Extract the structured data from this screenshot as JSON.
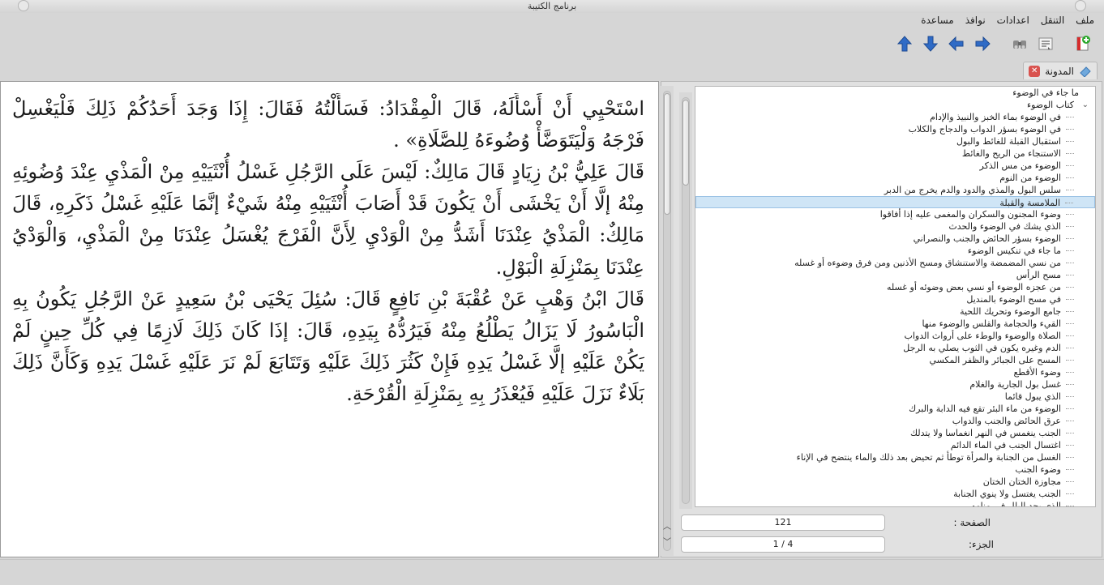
{
  "window": {
    "title": "برنامج الكتيبة"
  },
  "menu": [
    "ملف",
    "التنقل",
    "اعدادات",
    "نوافذ",
    "مساعدة"
  ],
  "toolbar": {
    "buttons": [
      "new-page-icon",
      "list-icon",
      "binoculars-icon",
      "arrow-right-icon",
      "arrow-left-icon",
      "arrow-down-icon",
      "arrow-up-icon"
    ]
  },
  "dock": {
    "tab_label": "المدونة"
  },
  "text": {
    "paragraphs": [
      "اسْتَحْيِي أَنْ أَسْأَلَهُ، قَالَ الْمِقْدَادُ: فَسَأَلْتُهُ فَقَالَ: إِذَا وَجَدَ أَحَدُكُمْ ذَلِكَ فَلْيَغْسِلْ فَرْجَهُ وَلْيَتَوَضَّأْ وُضُوءَهُ لِلصَّلَاةِ» .",
      "قَالَ عَلِيُّ بْنُ زِيَادٍ قَالَ مَالِكٌ: لَيْسَ عَلَى الرَّجُلِ غَسْلُ أُنْثَيَيْهِ مِنْ الْمَذْيِ عِنْدَ وُضُوئِهِ مِنْهُ إلَّا أَنْ يَخْشَى أَنْ يَكُونَ قَدْ أَصَابَ أُنْثَيَيْهِ مِنْهُ شَيْءٌ إنَّمَا عَلَيْهِ غَسْلُ ذَكَرِهِ، قَالَ مَالِكٌ: الْمَذْيُ عِنْدَنَا أَشَدُّ مِنْ الْوَدْيِ لِأَنَّ الْفَرْجَ يُغْسَلُ عِنْدَنَا مِنْ الْمَذْيِ، وَالْوَدْيُ عِنْدَنَا بِمَنْزِلَةِ الْبَوْلِ.",
      "قَالَ ابْنُ وَهْبٍ عَنْ عُقْبَةَ بْنِ نَافِعٍ قَالَ: سُئِلَ يَحْيَى بْنُ سَعِيدٍ عَنْ الرَّجُلِ يَكُونُ بِهِ الْبَاسُورُ لَا يَزَالُ يَطْلُعُ مِنْهُ فَيَرُدُّهُ بِيَدِهِ، قَالَ: إذَا كَانَ ذَلِكَ لَازِمًا فِي كُلِّ حِينٍ لَمْ يَكُنْ عَلَيْهِ إلَّا غَسْلُ يَدِهِ فَإِنْ كَثُرَ ذَلِكَ عَلَيْهِ وَتَتَابَعَ لَمْ نَرَ عَلَيْهِ غَسْلَ يَدِهِ وَكَأَنَّ ذَلِكَ بَلَاءٌ نَزَلَ عَلَيْهِ فَيُعْذَرُ بِهِ بِمَنْزِلَةِ الْقُرْحَةِ."
    ]
  },
  "tree": {
    "items": [
      {
        "label": "ما جاء في الوضوء",
        "level": "top"
      },
      {
        "label": "كتاب الوضوء",
        "level": "cat",
        "expanded": true
      },
      {
        "label": "في الوضوء بماء الخبز والنبيذ والإدام",
        "level": "sub"
      },
      {
        "label": "في الوضوء بسؤر الدواب والدجاج والكلاب",
        "level": "sub"
      },
      {
        "label": "استقبال القبلة للغائط والبول",
        "level": "sub"
      },
      {
        "label": "الاستنجاء من الريح والغائط",
        "level": "sub"
      },
      {
        "label": "الوضوء من مس الذكر",
        "level": "sub"
      },
      {
        "label": "الوضوء من النوم",
        "level": "sub"
      },
      {
        "label": "سلس البول والمذي والدود والدم يخرج من الدبر",
        "level": "sub"
      },
      {
        "label": "الملامسة والقبلة",
        "level": "sub",
        "selected": true
      },
      {
        "label": "وضوء المجنون والسكران والمغمى عليه إذا أفاقوا",
        "level": "sub"
      },
      {
        "label": "الذي يشك في الوضوء والحدث",
        "level": "sub"
      },
      {
        "label": "الوضوء بسؤر الحائض والجنب والنصراني",
        "level": "sub"
      },
      {
        "label": "ما جاء في تنكيس الوضوء",
        "level": "sub"
      },
      {
        "label": "من نسي المضمضة والاستنشاق ومسح الأذنين ومن فرق وضوءه أو غسله",
        "level": "sub"
      },
      {
        "label": "مسح الرأس",
        "level": "sub"
      },
      {
        "label": "من عجزه الوضوء أو نسي بعض وضوئه أو غسله",
        "level": "sub"
      },
      {
        "label": "في مسح الوضوء بالمنديل",
        "level": "sub"
      },
      {
        "label": "جامع الوضوء وتحريك اللحية",
        "level": "sub"
      },
      {
        "label": "القيء والحجامة والقلس والوضوء منها",
        "level": "sub"
      },
      {
        "label": "الصلاة والوضوء والوطء على أرواث الدواب",
        "level": "sub"
      },
      {
        "label": "الدم وغيره يكون في الثوب يصلي به الرجل",
        "level": "sub"
      },
      {
        "label": "المسح على الجبائر والظفر المكسي",
        "level": "sub"
      },
      {
        "label": "وضوء الأقطع",
        "level": "sub"
      },
      {
        "label": "غسل بول الجارية والغلام",
        "level": "sub"
      },
      {
        "label": "الذي يبول قائما",
        "level": "sub"
      },
      {
        "label": "الوضوء من ماء البئر تقع فيه الدابة والبرك",
        "level": "sub"
      },
      {
        "label": "عرق الحائض والجنب والدواب",
        "level": "sub"
      },
      {
        "label": "الجنب ينغمس في النهر انغماسا ولا يتدلك",
        "level": "sub"
      },
      {
        "label": "اغتسال الجنب في الماء الدائم",
        "level": "sub"
      },
      {
        "label": "الغسل من الجنابة والمرأة توطأ ثم تحيض بعد ذلك والماء ينتضح في الإناء",
        "level": "sub"
      },
      {
        "label": "وضوء الجنب",
        "level": "sub"
      },
      {
        "label": "مجاوزة الختان الختان",
        "level": "sub"
      },
      {
        "label": "الجنب يغتسل ولا ينوي الجنابة",
        "level": "sub"
      },
      {
        "label": "الذي يجد البلل في منامه",
        "level": "sub"
      }
    ]
  },
  "fields": {
    "page_label": "الصفحة :",
    "page_value": "121",
    "part_label": "الجزء:",
    "part_value": "1 / 4"
  }
}
